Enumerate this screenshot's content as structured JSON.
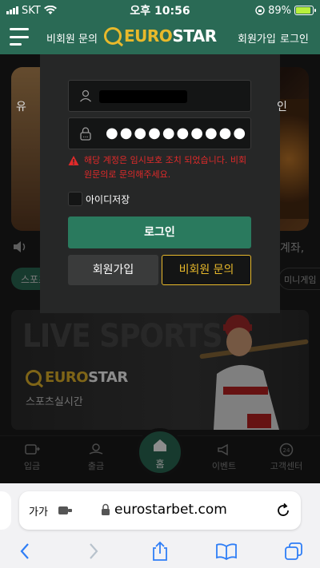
{
  "status_bar": {
    "carrier": "SKT",
    "time": "오후 10:56",
    "battery": "89%"
  },
  "header": {
    "inquiry_label": "비회원 문의",
    "logo_euro": "EURO",
    "logo_star": "STAR",
    "join_label": "회원가입",
    "login_label": "로그인"
  },
  "background": {
    "banner_left_text": "유",
    "banner_right_text": "인",
    "right_text": "계좌,",
    "chip_left": "스포츠",
    "chip_right": "미니게임",
    "live_title": "LIVE SPORTS",
    "live_logo_euro": "EURO",
    "live_logo_star": "STAR",
    "live_subtitle": "스포츠실시간"
  },
  "login_modal": {
    "password_mask": "●●●●●●●●●●",
    "error_message": "해당 계정은 임시보호 조치 되었습니다. 비회원문의로 문의해주세요.",
    "remember_label": "아이디저장",
    "login_button": "로그인",
    "join_button": "회원가입",
    "inquiry_button": "비회원 문의"
  },
  "bottom_nav": {
    "deposit": "입금",
    "withdraw": "출금",
    "home": "홈",
    "event": "이벤트",
    "support": "고객센터"
  },
  "browser": {
    "text_size": "가가",
    "url": "eurostarbet.com"
  },
  "colors": {
    "brand_green": "#2a6a55",
    "accent_gold": "#e8b92b",
    "error_red": "#e02a2a"
  }
}
